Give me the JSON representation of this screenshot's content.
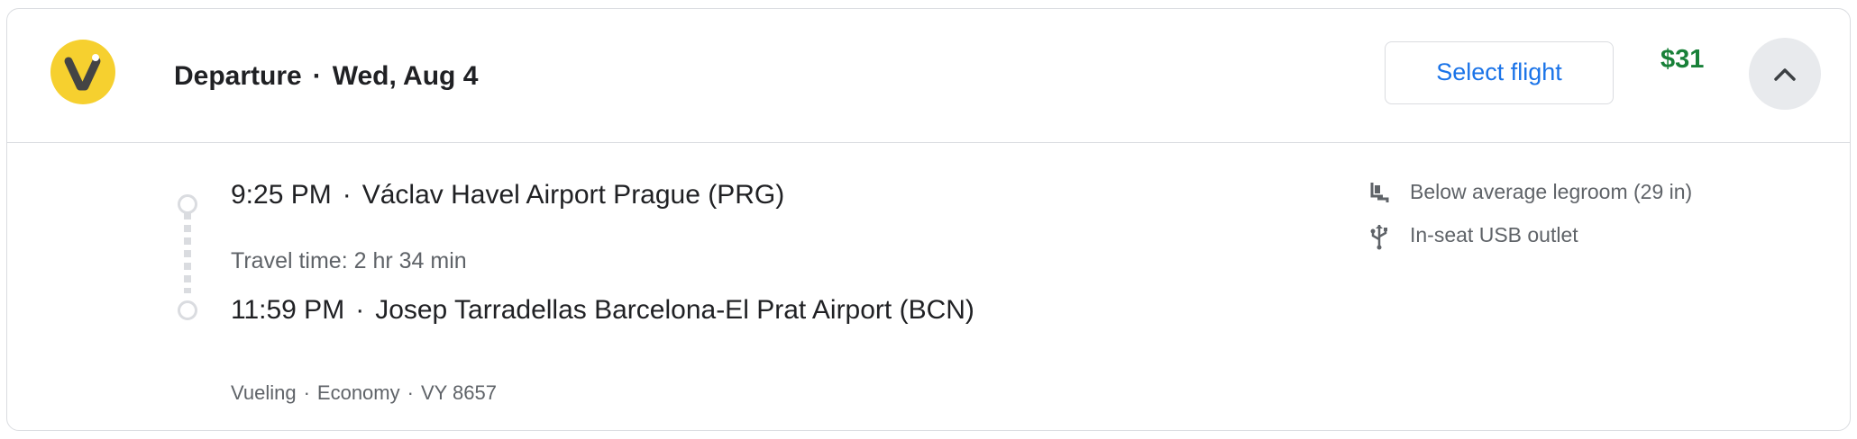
{
  "header": {
    "logo_icon": "vueling-logo-icon",
    "label": "Departure",
    "separator": "·",
    "date": "Wed, Aug 4",
    "select_label": "Select flight",
    "price": "$31",
    "collapse_icon": "chevron-up-icon"
  },
  "itinerary": {
    "departure": {
      "time": "9:25 PM",
      "separator": "·",
      "airport": "Václav Havel Airport Prague (PRG)"
    },
    "travel_time": "Travel time: 2 hr 34 min",
    "arrival": {
      "time": "11:59 PM",
      "separator": "·",
      "airport": "Josep Tarradellas Barcelona-El Prat Airport (BCN)"
    },
    "meta": {
      "airline": "Vueling",
      "cabin": "Economy",
      "flight": "VY 8657",
      "separator": "·"
    }
  },
  "amenities": [
    {
      "icon": "legroom-seat-icon",
      "label": "Below average legroom (29 in)"
    },
    {
      "icon": "usb-icon",
      "label": "In-seat USB outlet"
    }
  ],
  "colors": {
    "accent_blue": "#1a73e8",
    "price_green": "#188038",
    "logo_yellow": "#f6d02f",
    "border": "#dadce0"
  }
}
